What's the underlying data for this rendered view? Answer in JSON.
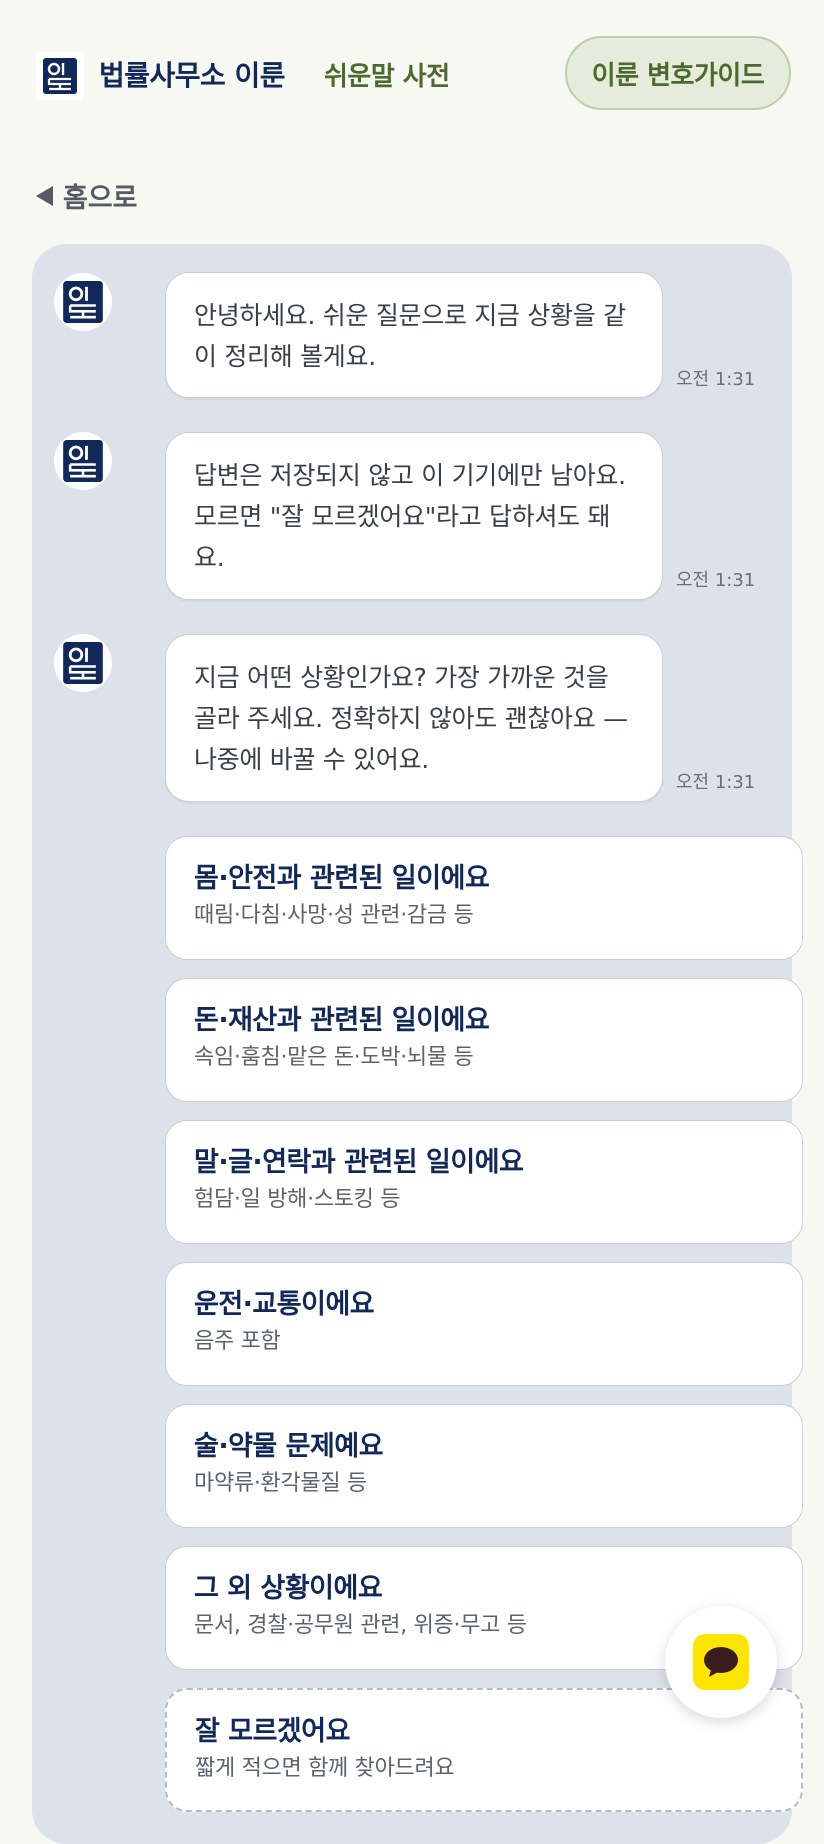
{
  "header": {
    "brand": "법률사무소 이룬",
    "dict_link": "쉬운말 사전",
    "guide_button": "이룬 변호가이드",
    "logo_icon": "law-book-icon"
  },
  "nav": {
    "back_label": "홈으로",
    "back_icon": "triangle-left-icon"
  },
  "messages": [
    {
      "text": "안녕하세요. 쉬운 질문으로 지금 상황을 같이 정리해 볼게요.",
      "time": "오전 1:31"
    },
    {
      "text": "답변은 저장되지 않고 이 기기에만 남아요. 모르면 \"잘 모르겠어요\"라고 답하셔도 돼요.",
      "time": "오전 1:31"
    },
    {
      "text": "지금 어떤 상황인가요? 가장 가까운 것을 골라 주세요. 정확하지 않아도 괜찮아요 — 나중에 바꿀 수 있어요.",
      "time": "오전 1:31"
    }
  ],
  "options": [
    {
      "title": "몸·안전과 관련된 일이에요",
      "subtitle": "때림·다침·사망·성 관련·감금 등"
    },
    {
      "title": "돈·재산과 관련된 일이에요",
      "subtitle": "속임·훔침·맡은 돈·도박·뇌물 등"
    },
    {
      "title": "말·글·연락과 관련된 일이에요",
      "subtitle": "험담·일 방해·스토킹 등"
    },
    {
      "title": "운전·교통이에요",
      "subtitle": "음주 포함"
    },
    {
      "title": "술·약물 문제예요",
      "subtitle": "마약류·환각물질 등"
    },
    {
      "title": "그 외 상황이에요",
      "subtitle": "문서, 경찰·공무원 관련, 위증·무고 등"
    },
    {
      "title": "잘 모르겠어요",
      "subtitle": "짧게 적으면 함께 찾아드려요"
    }
  ],
  "fab": {
    "icon": "chat-bubble-icon",
    "color": "#fee500"
  },
  "colors": {
    "brand": "#11295a",
    "accent_green": "#4c6a2e",
    "panel_bg": "#dde1e9"
  }
}
